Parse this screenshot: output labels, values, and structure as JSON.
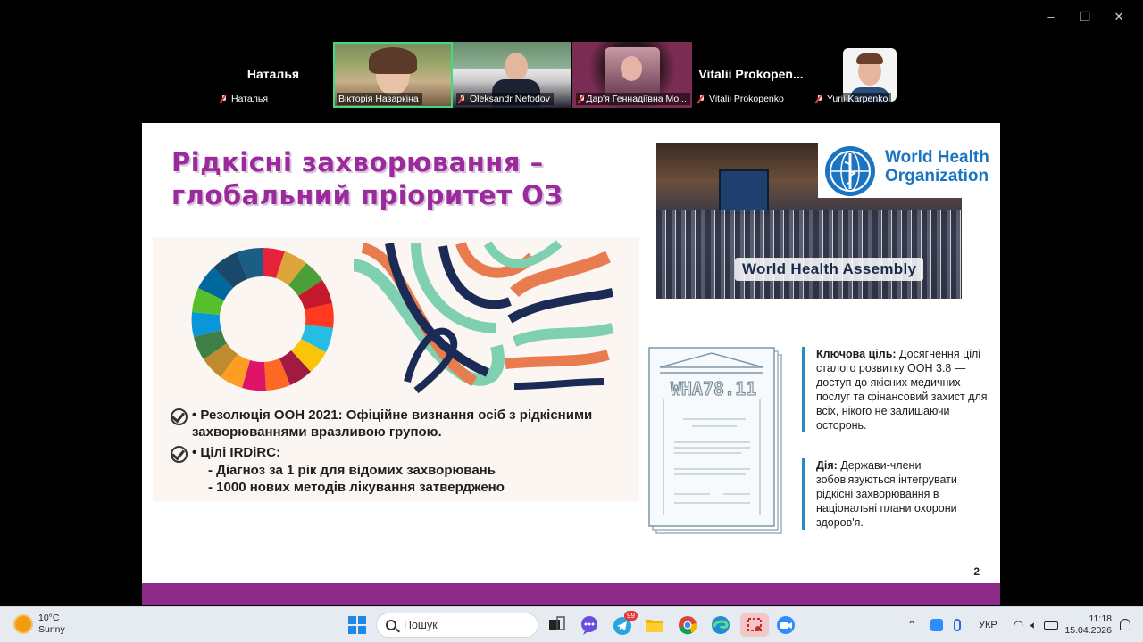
{
  "window": {
    "minimize": "–",
    "restore": "❐",
    "close": "✕"
  },
  "participants": [
    {
      "kind": "name",
      "big_name": "Наталья",
      "label": "Наталья"
    },
    {
      "kind": "video",
      "label": "Вікторія Назаркіна",
      "active": true
    },
    {
      "kind": "video",
      "label": "Oleksandr Nefodov"
    },
    {
      "kind": "video",
      "label": "Дар'я Геннадіївна Мо..."
    },
    {
      "kind": "name",
      "big_name": "Vitalii  Prokopen...",
      "label": "Vitalii Prokopenko"
    },
    {
      "kind": "video",
      "label": "Yurii Karpenko"
    }
  ],
  "slide": {
    "title_line1": "Рідкісні захворювання –",
    "title_line2": "глобальний  пріоритет ОЗ",
    "bullet1": "• Резолюція ООН 2021: Офіційне визнання осіб з рідкісними захворюваннями вразливою групою.",
    "bullet2_head": "• Цілі IRDiRC:",
    "bullet2_sub1": "- Діагноз за 1 рік для відомих захворювань",
    "bullet2_sub2": "- 1000 нових методів лікування затверджено",
    "who_line1": "World Health",
    "who_line2": "Organization",
    "wha_banner": "World Health Assembly",
    "doc_code": "WHA78.11",
    "info1_bold": "Ключова ціль:",
    "info1_text": " Досягнення цілі сталого розвитку ООН 3.8 — доступ до якісних медичних послуг та фінансовий захист для всіх, нікого не залишаючи осторонь.",
    "info2_bold": "Дія:",
    "info2_text": " Держави-члени зобов'язуються інтегрувати рідкісні захворювання в національні плани охорони здоров'я.",
    "page_number": "2",
    "colors": {
      "title": "#9b2a9a",
      "footer": "#8e2a8a",
      "accent": "#2a8bc9",
      "who_blue": "#1a74c2"
    }
  },
  "taskbar": {
    "temp": "10°C",
    "weather": "Sunny",
    "search_placeholder": "Пошук",
    "lang": "УКР",
    "time": "11:18",
    "date": "15.04.2026",
    "telegram_badge": "99"
  }
}
